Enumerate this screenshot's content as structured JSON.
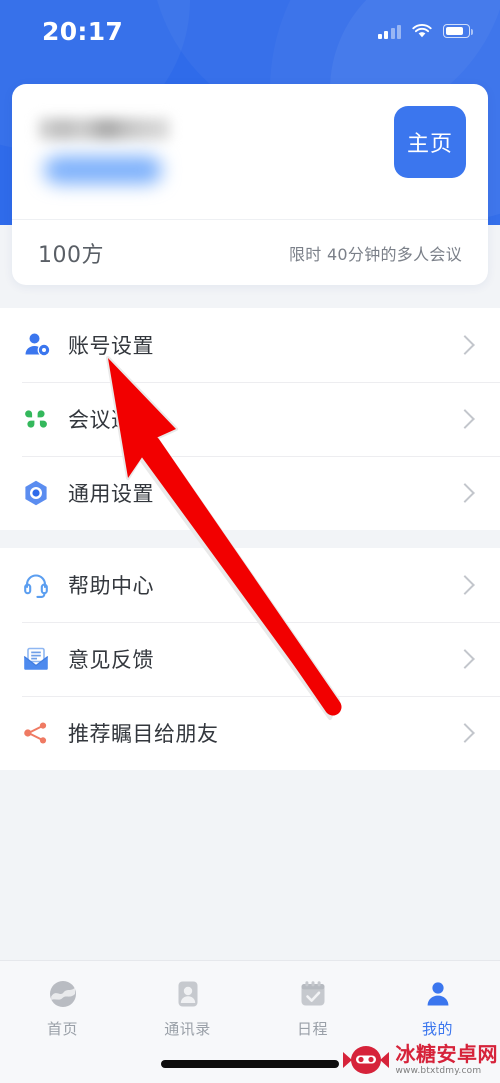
{
  "status_bar": {
    "time": "20:17",
    "signal_icon": "cellular-signal-icon",
    "wifi_icon": "wifi-icon",
    "battery_icon": "battery-icon"
  },
  "profile_card": {
    "name_masked": "",
    "id_badge_masked": "",
    "home_button_label": "主页",
    "capacity": "100方",
    "capacity_desc": "限时 40分钟的多人会议"
  },
  "menu": {
    "group_a": [
      {
        "icon": "account-settings-icon",
        "label": "账号设置",
        "chevron": "chevron-right-icon"
      },
      {
        "icon": "meeting-options-icon",
        "label": "会议选项",
        "chevron": "chevron-right-icon"
      },
      {
        "icon": "general-settings-icon",
        "label": "通用设置",
        "chevron": "chevron-right-icon"
      }
    ],
    "group_b": [
      {
        "icon": "headset-icon",
        "label": "帮助中心",
        "chevron": "chevron-right-icon"
      },
      {
        "icon": "envelope-icon",
        "label": "意见反馈",
        "chevron": "chevron-right-icon"
      },
      {
        "icon": "share-icon",
        "label": "推荐瞩目给朋友",
        "chevron": "chevron-right-icon"
      }
    ]
  },
  "tabbar": [
    {
      "icon": "home-globe-icon",
      "label": "首页",
      "active": false
    },
    {
      "icon": "contacts-icon",
      "label": "通讯录",
      "active": false
    },
    {
      "icon": "calendar-check-icon",
      "label": "日程",
      "active": false
    },
    {
      "icon": "person-icon",
      "label": "我的",
      "active": true
    }
  ],
  "watermark": {
    "title": "冰糖安卓网",
    "url": "www.btxtdmy.com"
  },
  "annotation": {
    "arrow": "red-pointer-arrow",
    "target": "账号设置"
  },
  "colors": {
    "header_blue": "#2f6bea",
    "accent_blue": "#3b76ee",
    "page_bg": "#f2f4f7",
    "green": "#34b85c",
    "salmon": "#ef7a63",
    "watermark_red": "#d6233a"
  }
}
